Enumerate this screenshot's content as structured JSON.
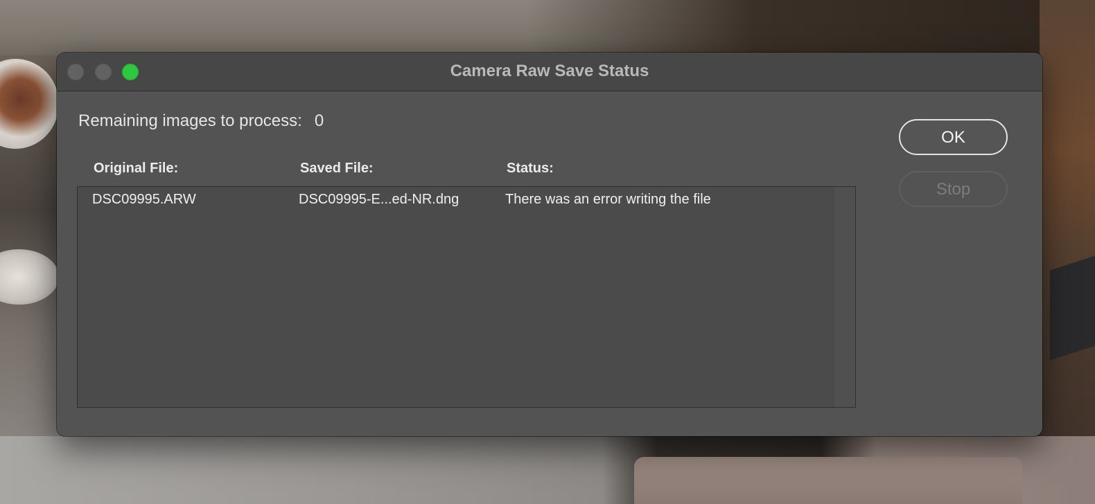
{
  "window": {
    "title": "Camera Raw Save Status"
  },
  "remaining": {
    "label": "Remaining images to process:",
    "count": "0"
  },
  "table": {
    "headers": {
      "original": "Original File:",
      "saved": "Saved File:",
      "status": "Status:"
    },
    "rows": [
      {
        "original": "DSC09995.ARW",
        "saved": "DSC09995-E...ed-NR.dng",
        "status": "There was an error writing the file"
      }
    ]
  },
  "buttons": {
    "ok": "OK",
    "stop": "Stop",
    "stop_enabled": false
  },
  "colors": {
    "zoom_button": "#2ec840",
    "window_background": "#535353",
    "titlebar_background": "#474747"
  },
  "icons": {
    "close": "window-close-dot",
    "minimize": "window-minimize-dot",
    "zoom": "window-zoom-dot"
  }
}
